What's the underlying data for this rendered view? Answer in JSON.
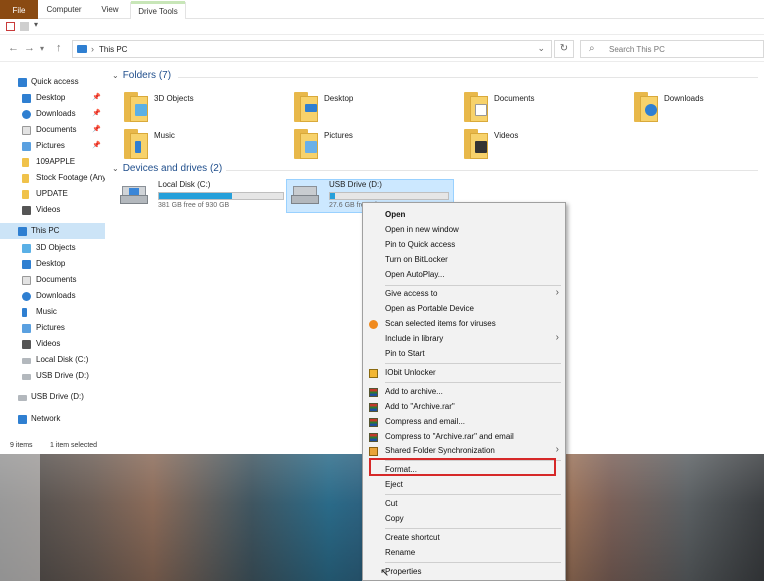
{
  "ribbon": {
    "tabs": [
      "File",
      "Computer",
      "View",
      "Drive Tools"
    ]
  },
  "address": {
    "path": "This PC",
    "search_placeholder": "Search This PC"
  },
  "navpane": {
    "quick_access": "Quick access",
    "items": [
      {
        "label": "Desktop",
        "pinned": true
      },
      {
        "label": "Downloads",
        "pinned": true
      },
      {
        "label": "Documents",
        "pinned": true
      },
      {
        "label": "Pictures",
        "pinned": true
      },
      {
        "label": "109APPLE",
        "pinned": false
      },
      {
        "label": "Stock Footage (Any",
        "pinned": false
      },
      {
        "label": "UPDATE",
        "pinned": false
      },
      {
        "label": "Videos",
        "pinned": false
      }
    ],
    "this_pc": "This PC",
    "pc_items": [
      "3D Objects",
      "Desktop",
      "Documents",
      "Downloads",
      "Music",
      "Pictures",
      "Videos",
      "Local Disk (C:)",
      "USB Drive (D:)"
    ],
    "usb": "USB Drive (D:)",
    "network": "Network",
    "pin_glyph": "📌"
  },
  "status": {
    "items": "9 items",
    "selected": "1 item selected"
  },
  "folders": {
    "header": "Folders (7)",
    "list": [
      "3D Objects",
      "Desktop",
      "Documents",
      "Downloads",
      "Music",
      "Pictures",
      "Videos"
    ]
  },
  "drives": {
    "header": "Devices and drives (2)",
    "list": [
      {
        "name": "Local Disk (C:)",
        "free": "381 GB free of 930 GB",
        "used_fraction": 0.59
      },
      {
        "name": "USB Drive (D:)",
        "free": "27.6 GB free of 28.6 GB",
        "used_fraction": 0.04
      }
    ]
  },
  "context_menu": {
    "items": [
      {
        "label": "Open",
        "bold": true
      },
      {
        "label": "Open in new window"
      },
      {
        "label": "Pin to Quick access"
      },
      {
        "label": "Turn on BitLocker"
      },
      {
        "label": "Open AutoPlay..."
      },
      {
        "label": "Give access to",
        "submenu": true
      },
      {
        "label": "Open as Portable Device"
      },
      {
        "label": "Scan selected items for viruses"
      },
      {
        "label": "Include in library",
        "submenu": true
      },
      {
        "label": "Pin to Start"
      },
      {
        "label": "IObit Unlocker"
      },
      {
        "label": "Add to archive..."
      },
      {
        "label": "Add to \"Archive.rar\""
      },
      {
        "label": "Compress and email..."
      },
      {
        "label": "Compress to \"Archive.rar\" and email"
      },
      {
        "label": "Shared Folder Synchronization",
        "submenu": true
      },
      {
        "label": "Format..."
      },
      {
        "label": "Eject"
      },
      {
        "label": "Cut"
      },
      {
        "label": "Copy"
      },
      {
        "label": "Create shortcut"
      },
      {
        "label": "Rename"
      },
      {
        "label": "Properties"
      }
    ],
    "highlighted": "Format..."
  },
  "colors": {
    "file_tab": "#8a4a12",
    "accent": "#26a0da",
    "selection": "#cce8ff",
    "highlight_box": "#d62828"
  }
}
